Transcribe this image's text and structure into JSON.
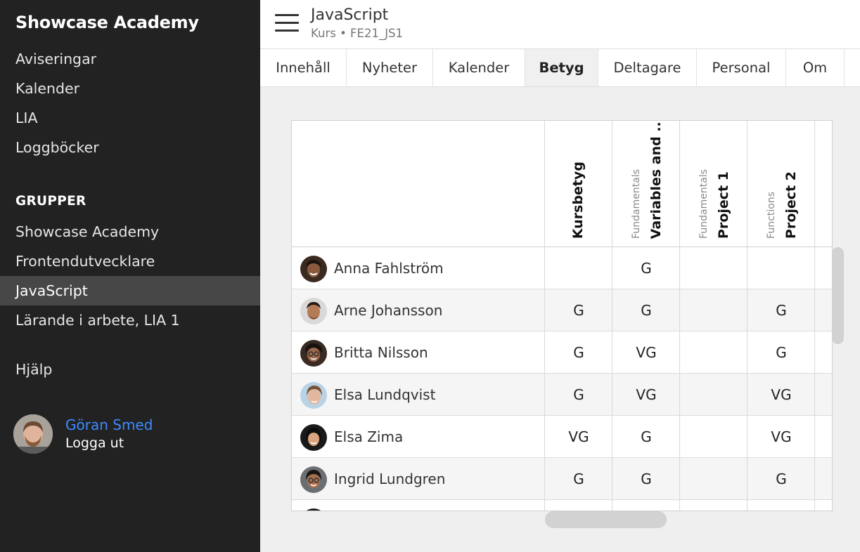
{
  "sidebar": {
    "brand": "Showcase Academy",
    "nav": [
      "Aviseringar",
      "Kalender",
      "LIA",
      "Loggböcker"
    ],
    "groups_heading": "GRUPPER",
    "groups": [
      "Showcase Academy",
      "Frontendutvecklare",
      "JavaScript",
      "Lärande i arbete, LIA 1"
    ],
    "active_group": "JavaScript",
    "help": "Hjälp",
    "user": {
      "name": "Göran Smed",
      "logout": "Logga ut"
    }
  },
  "header": {
    "menu_icon": "hamburger-menu-icon",
    "title": "JavaScript",
    "subtitle": "Kurs • FE21_JS1"
  },
  "tabs": [
    "Innehåll",
    "Nyheter",
    "Kalender",
    "Betyg",
    "Deltagare",
    "Personal",
    "Om"
  ],
  "active_tab": "Betyg",
  "grades": {
    "columns": [
      {
        "category": "",
        "title": "Kursbetyg"
      },
      {
        "category": "Fundamentals",
        "title": "Variables and ..."
      },
      {
        "category": "Fundamentals",
        "title": "Project 1"
      },
      {
        "category": "Functions",
        "title": "Project 2"
      }
    ],
    "students": [
      {
        "name": "Anna Fahlström",
        "grades": [
          "",
          "G",
          "",
          ""
        ]
      },
      {
        "name": "Arne Johansson",
        "grades": [
          "G",
          "G",
          "",
          "G"
        ]
      },
      {
        "name": "Britta Nilsson",
        "grades": [
          "G",
          "VG",
          "",
          "G"
        ]
      },
      {
        "name": "Elsa Lundqvist",
        "grades": [
          "G",
          "VG",
          "",
          "VG"
        ]
      },
      {
        "name": "Elsa Zima",
        "grades": [
          "VG",
          "G",
          "",
          "VG"
        ]
      },
      {
        "name": "Ingrid Lundgren",
        "grades": [
          "G",
          "G",
          "",
          "G"
        ]
      }
    ]
  },
  "colors": {
    "sidebar_bg": "#222222",
    "active_bg": "#474747",
    "link_blue": "#3d8bff"
  }
}
